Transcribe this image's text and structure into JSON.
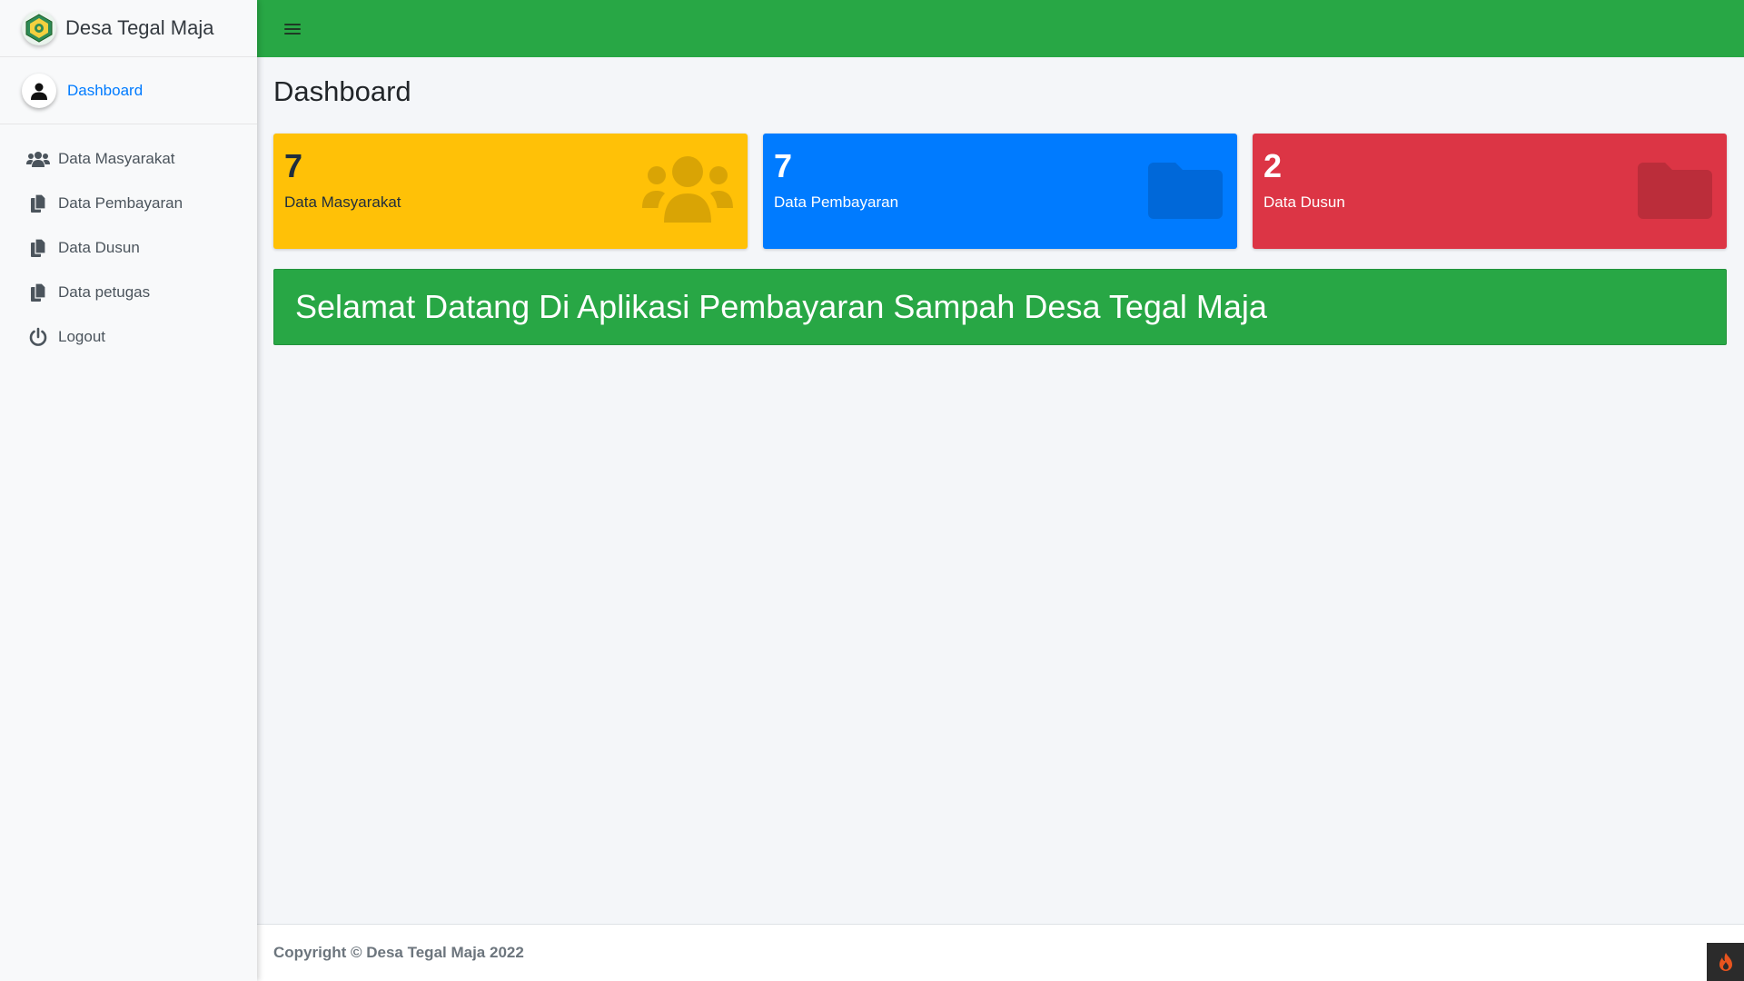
{
  "brand": {
    "title": "Desa Tegal Maja",
    "logo_icon": "village-emblem-icon"
  },
  "user": {
    "name": "Dashboard",
    "avatar_icon": "user-icon"
  },
  "sidebar": {
    "items": [
      {
        "label": "Data Masyarakat",
        "icon": "users-icon"
      },
      {
        "label": "Data Pembayaran",
        "icon": "copy-icon"
      },
      {
        "label": "Data Dusun",
        "icon": "copy-icon"
      },
      {
        "label": "Data petugas",
        "icon": "copy-icon"
      },
      {
        "label": "Logout",
        "icon": "power-icon"
      }
    ]
  },
  "header": {
    "menu_icon": "hamburger-icon",
    "color": "#28a745"
  },
  "page": {
    "title": "Dashboard"
  },
  "boxes": [
    {
      "value": "7",
      "label": "Data Masyarakat",
      "color": "#ffc107",
      "icon": "users-icon"
    },
    {
      "value": "7",
      "label": "Data Pembayaran",
      "color": "#007bff",
      "icon": "folder-icon"
    },
    {
      "value": "2",
      "label": "Data Dusun",
      "color": "#dc3545",
      "icon": "folder-icon"
    }
  ],
  "welcome": {
    "text": "Selamat Datang Di Aplikasi Pembayaran Sampah Desa Tegal Maja"
  },
  "footer": {
    "text": "Copyright © Desa Tegal Maja 2022"
  }
}
